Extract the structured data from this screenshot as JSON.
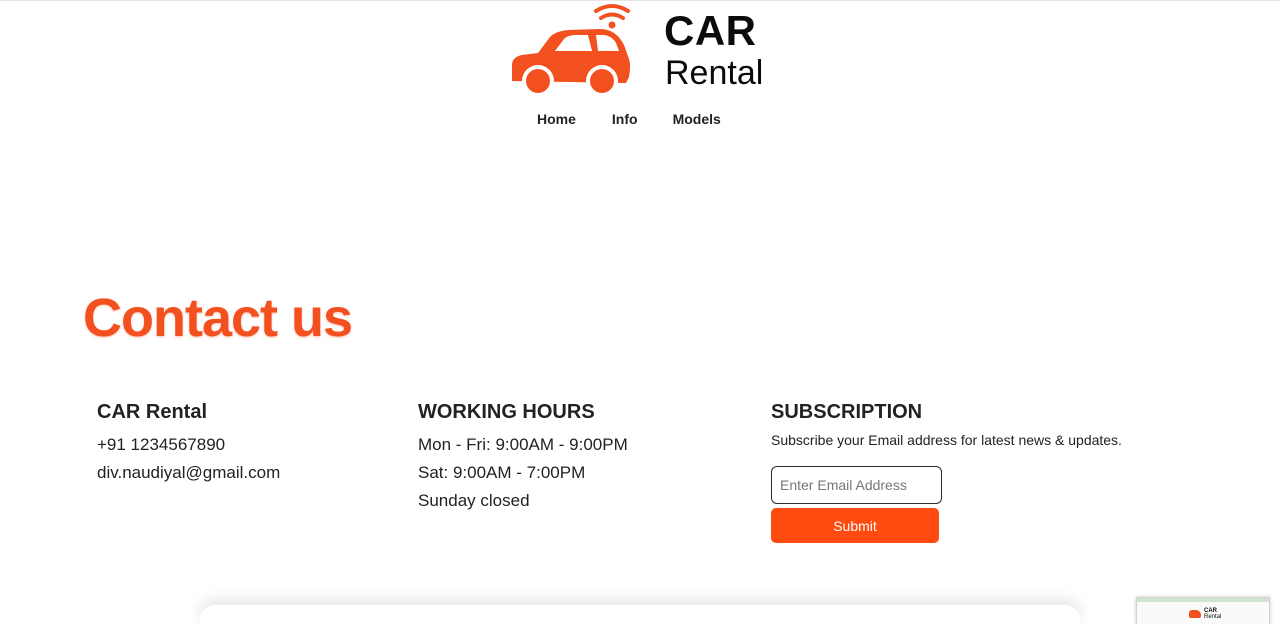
{
  "brand": {
    "title": "CAR",
    "subtitle": "Rental",
    "accent_color": "#f2501f",
    "logo_icon": "car-wifi-icon"
  },
  "nav": {
    "items": [
      {
        "label": "Home"
      },
      {
        "label": "Info"
      },
      {
        "label": "Models"
      }
    ]
  },
  "contact": {
    "heading": "Contact us",
    "company": {
      "name": "CAR Rental",
      "phone": "+91 1234567890",
      "email": "div.naudiyal@gmail.com"
    },
    "hours": {
      "heading": "WORKING HOURS",
      "lines": [
        "Mon - Fri: 9:00AM - 9:00PM",
        "Sat: 9:00AM - 7:00PM",
        "Sunday closed"
      ]
    },
    "subscription": {
      "heading": "SUBSCRIPTION",
      "description": "Subscribe your Email address for latest news & updates.",
      "email_placeholder": "Enter Email Address",
      "email_value": "",
      "submit_label": "Submit",
      "button_color": "#ff4a10"
    }
  },
  "thumbnail": {
    "mini_title": "CAR",
    "mini_subtitle": "Rental"
  }
}
